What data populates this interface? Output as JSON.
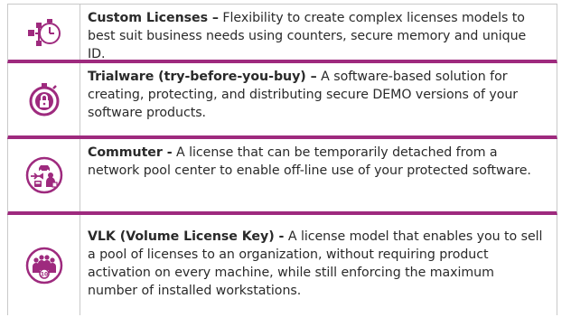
{
  "colors": {
    "accent": "#9e2a7e",
    "border": "#c9c9c9",
    "text": "#2a2a2a"
  },
  "license_models": [
    {
      "icon": "flowchart-timer-icon",
      "title": "Custom Licenses –",
      "description": " Flexibility to create complex licenses models to best suit business needs using counters, secure memory and unique ID."
    },
    {
      "icon": "stopwatch-lock-icon",
      "title": "Trialware (try-before-you-buy) –",
      "description": " A software-based solution for creating, protecting, and distributing secure DEMO versions of your software products."
    },
    {
      "icon": "commuter-travel-icon",
      "title": "Commuter -",
      "description": " A license that can be temporarily detached from a network pool center to enable off-line use of your protected software."
    },
    {
      "icon": "group-users-icon",
      "title": "VLK (Volume License Key) -",
      "description": " A license model that enables you to sell a pool of licenses to an organization, without requiring product activation on every machine, while still enforcing the maximum number of installed workstations."
    }
  ]
}
